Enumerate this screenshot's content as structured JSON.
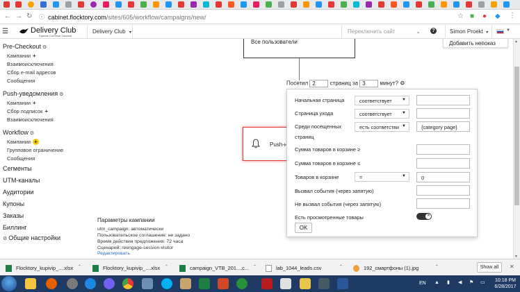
{
  "browser": {
    "url_host": "cabinet.flocktory.com",
    "url_path": "/sites/605/workflow/campaigns/new/"
  },
  "header": {
    "logo_name": "Delivery Club",
    "logo_tagline": "Единая Система Заказов",
    "site_select": "Delivery Club",
    "switch_site": "Переключить сайт",
    "user": "Simon Proekt",
    "add_exclusion": "Добавить непоказ"
  },
  "sidebar": {
    "prechk": "Pre-Checkout",
    "prechk_items": [
      "Кампании",
      "Взаимоисключения",
      "Сбор e-mail адресов",
      "Сообщения"
    ],
    "push": "Push-уведомления",
    "push_items": [
      "Кампании",
      "Сбор подписок",
      "Взаимоисключения"
    ],
    "workflow": "Workflow",
    "workflow_items": [
      "Кампании",
      "Групповое ограничение",
      "Сообщения"
    ],
    "sections": [
      "Сегменты",
      "UTM-каналы",
      "Аудитории",
      "Купоны",
      "Заказы",
      "Биллинг",
      "Общие настройки"
    ]
  },
  "canvas": {
    "all_users": "Все пользователи",
    "visited": "Посетил",
    "pages_in": "страниц за",
    "minutes": "минут?",
    "pages_value": "2",
    "minutes_value": "3",
    "push_label": "Push-н"
  },
  "condition": {
    "start_page": "Начальная страница",
    "start_op": "соответствует",
    "exit_page": "Страница ухода",
    "exit_op": "соответствует",
    "visited_pages_1": "Среди посещенных",
    "visited_pages_2": "страниц",
    "visited_op": "есть соответстви",
    "visited_value": "{category page}",
    "cart_sum_gte": "Сумма товаров в корзине ≥",
    "cart_sum_lte": "Сумма товаров в корзине ≤",
    "cart_count": "Товаров в корзине",
    "cart_count_op": "=",
    "cart_count_value": "0",
    "events_fired": "Вызвал события (через запятую)",
    "events_not_fired": "Не вызвал события (через запятую)",
    "viewed_items": "Есть просмотренные товары",
    "ok": "OK"
  },
  "params": {
    "title": "Параметры кампании",
    "lines": [
      "utm_campaign: автоматически",
      "Пользовательское соглашение: не задано",
      "Время действия предложения: 72 часа",
      "Сценарий: reengage-session-visitor"
    ],
    "edit": "Редактировать"
  },
  "downloads": {
    "files": [
      "Flocktory_kupivip_....xlsx",
      "Flocktory_kupivip_....xlsx",
      "campaign_VTB_201....c...",
      "lab_1044_leads.csv",
      "192_смартфоны (1).jpg"
    ],
    "show_all": "Show all"
  },
  "taskbar": {
    "lang": "EN",
    "time": "10:18 PM",
    "date": "6/28/2017"
  },
  "colors": {
    "accent_red": "#e53935",
    "plus_active": "#f5d000",
    "taskbar": "#1f3b63"
  }
}
